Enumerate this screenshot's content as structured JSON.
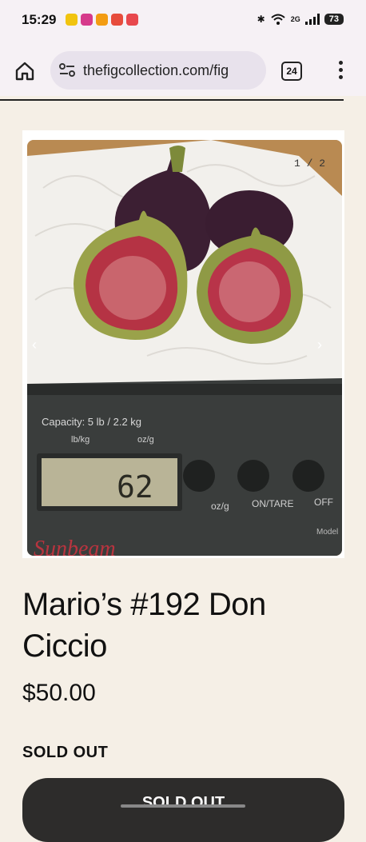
{
  "status_bar": {
    "time": "15:29",
    "battery": "73",
    "network": "2G"
  },
  "browser": {
    "url": "thefigcollection.com/fig",
    "tab_count": "24"
  },
  "gallery": {
    "counter": "1 / 2",
    "prev_label": "‹",
    "next_label": "›"
  },
  "product": {
    "title": "Mario’s #192 Don Ciccio",
    "price": "$50.00",
    "availability": "SOLD OUT",
    "button_label": "SOLD OUT"
  },
  "scale": {
    "capacity": "Capacity: 5 lb / 2.2 kg",
    "unit_left": "lb/kg",
    "unit_right": "oz/g",
    "reading": "62",
    "btn1": "oz/g",
    "btn2": "ON/TARE",
    "btn3": "OFF",
    "brand": "Sunbeam",
    "model": "Model"
  }
}
